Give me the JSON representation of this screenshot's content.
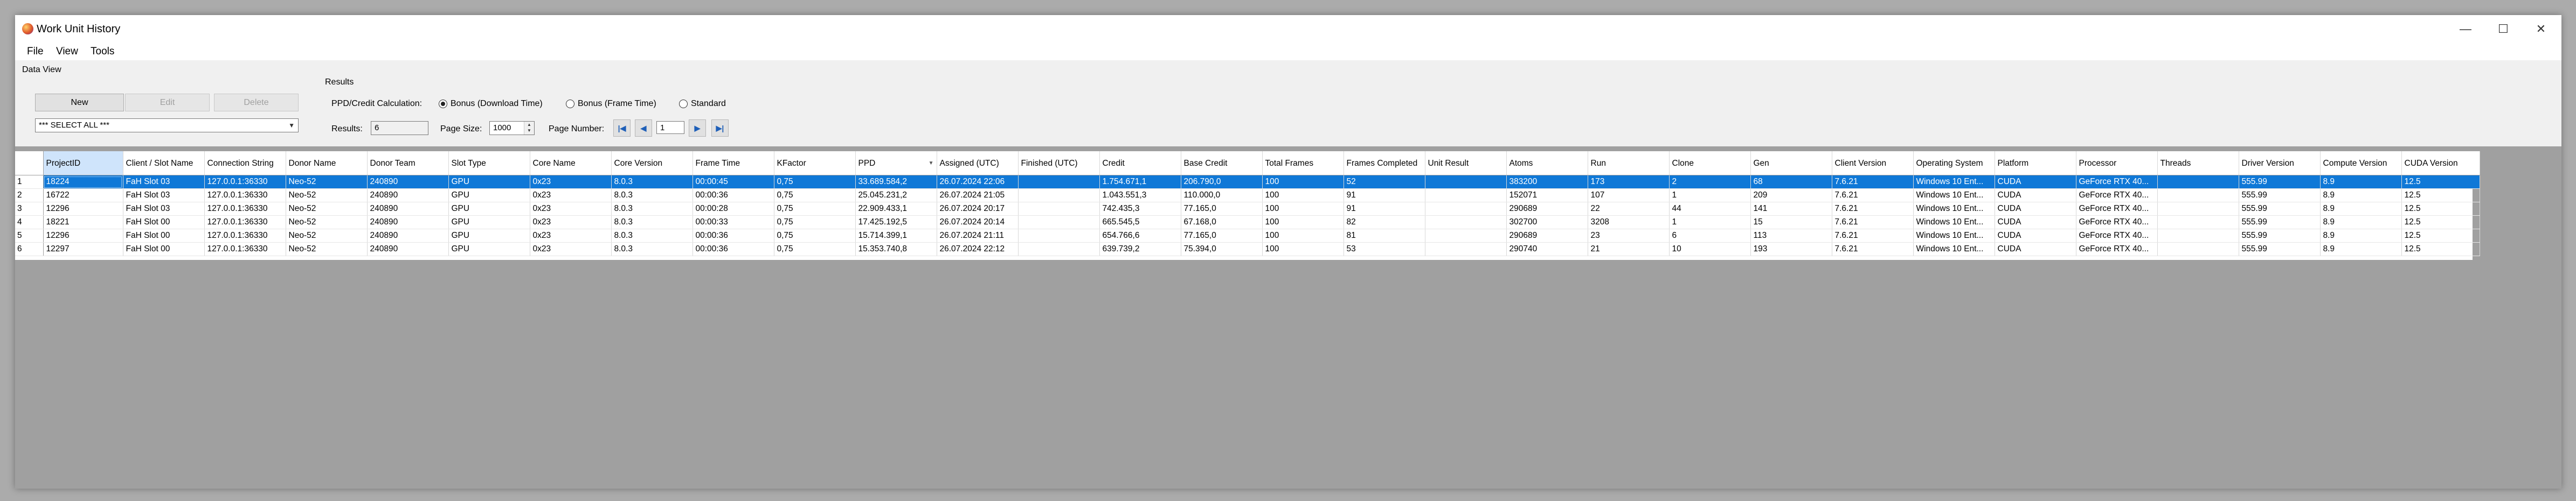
{
  "window": {
    "title": "Work Unit History",
    "controls": [
      "—",
      "☐",
      "✕"
    ]
  },
  "menu": [
    "File",
    "View",
    "Tools"
  ],
  "data_view": {
    "label": "Data View",
    "new_button": "New",
    "edit_button": "Edit",
    "delete_button": "Delete",
    "select": "*** SELECT ALL ***"
  },
  "results": {
    "label": "Results",
    "ppd_label": "PPD/Credit Calculation:",
    "options": [
      "Bonus (Download Time)",
      "Bonus (Frame Time)",
      "Standard"
    ],
    "selected_option": "Bonus (Download Time)",
    "results_label": "Results:",
    "results_value": "6",
    "page_size_label": "Page Size:",
    "page_size_value": "1000",
    "page_number_label": "Page Number:",
    "page_number_value": "1"
  },
  "table": {
    "columns": [
      "ProjectID",
      "Client / Slot Name",
      "Connection String",
      "Donor Name",
      "Donor Team",
      "Slot Type",
      "Core Name",
      "Core Version",
      "Frame Time",
      "KFactor",
      "PPD",
      "Assigned (UTC)",
      "Finished (UTC)",
      "Credit",
      "Base Credit",
      "Total Frames",
      "Frames Completed",
      "Unit Result",
      "Atoms",
      "Run",
      "Clone",
      "Gen",
      "Client Version",
      "Operating System",
      "Platform",
      "Processor",
      "Threads",
      "Driver Version",
      "Compute Version",
      "CUDA Version"
    ],
    "sorted_column": "PPD",
    "rows": [
      {
        "num": "1",
        "cells": [
          "18224",
          "FaH Slot 03",
          "127.0.0.1:36330",
          "Neo-52",
          "240890",
          "GPU",
          "0x23",
          "8.0.3",
          "00:00:45",
          "0,75",
          "33.689.584,2",
          "26.07.2024 22:06",
          "",
          "1.754.671,1",
          "206.790,0",
          "100",
          "52",
          "",
          "383200",
          "173",
          "2",
          "68",
          "7.6.21",
          "Windows 10 Ent...",
          "CUDA",
          "GeForce RTX 40...",
          "",
          "555.99",
          "8.9",
          "12.5"
        ]
      },
      {
        "num": "2",
        "cells": [
          "16722",
          "FaH Slot 03",
          "127.0.0.1:36330",
          "Neo-52",
          "240890",
          "GPU",
          "0x23",
          "8.0.3",
          "00:00:36",
          "0,75",
          "25.045.231,2",
          "26.07.2024 21:05",
          "",
          "1.043.551,3",
          "110.000,0",
          "100",
          "91",
          "",
          "152071",
          "107",
          "1",
          "209",
          "7.6.21",
          "Windows 10 Ent...",
          "CUDA",
          "GeForce RTX 40...",
          "",
          "555.99",
          "8.9",
          "12.5"
        ]
      },
      {
        "num": "3",
        "cells": [
          "12296",
          "FaH Slot 03",
          "127.0.0.1:36330",
          "Neo-52",
          "240890",
          "GPU",
          "0x23",
          "8.0.3",
          "00:00:28",
          "0,75",
          "22.909.433,1",
          "26.07.2024 20:17",
          "",
          "742.435,3",
          "77.165,0",
          "100",
          "91",
          "",
          "290689",
          "22",
          "44",
          "141",
          "7.6.21",
          "Windows 10 Ent...",
          "CUDA",
          "GeForce RTX 40...",
          "",
          "555.99",
          "8.9",
          "12.5"
        ]
      },
      {
        "num": "4",
        "cells": [
          "18221",
          "FaH Slot 00",
          "127.0.0.1:36330",
          "Neo-52",
          "240890",
          "GPU",
          "0x23",
          "8.0.3",
          "00:00:33",
          "0,75",
          "17.425.192,5",
          "26.07.2024 20:14",
          "",
          "665.545,5",
          "67.168,0",
          "100",
          "82",
          "",
          "302700",
          "3208",
          "1",
          "15",
          "7.6.21",
          "Windows 10 Ent...",
          "CUDA",
          "GeForce RTX 40...",
          "",
          "555.99",
          "8.9",
          "12.5"
        ]
      },
      {
        "num": "5",
        "cells": [
          "12296",
          "FaH Slot 00",
          "127.0.0.1:36330",
          "Neo-52",
          "240890",
          "GPU",
          "0x23",
          "8.0.3",
          "00:00:36",
          "0,75",
          "15.714.399,1",
          "26.07.2024 21:11",
          "",
          "654.766,6",
          "77.165,0",
          "100",
          "81",
          "",
          "290689",
          "23",
          "6",
          "113",
          "7.6.21",
          "Windows 10 Ent...",
          "CUDA",
          "GeForce RTX 40...",
          "",
          "555.99",
          "8.9",
          "12.5"
        ]
      },
      {
        "num": "6",
        "cells": [
          "12297",
          "FaH Slot 00",
          "127.0.0.1:36330",
          "Neo-52",
          "240890",
          "GPU",
          "0x23",
          "8.0.3",
          "00:00:36",
          "0,75",
          "15.353.740,8",
          "26.07.2024 22:12",
          "",
          "639.739,2",
          "75.394,0",
          "100",
          "53",
          "",
          "290740",
          "21",
          "10",
          "193",
          "7.6.21",
          "Windows 10 Ent...",
          "CUDA",
          "GeForce RTX 40...",
          "",
          "555.99",
          "8.9",
          "12.5"
        ]
      }
    ]
  }
}
